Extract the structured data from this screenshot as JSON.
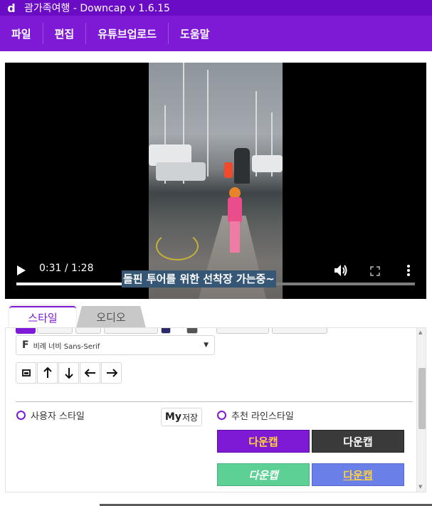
{
  "window": {
    "logo_glyph": "d",
    "title": "괌가족여행 - Downcap v 1.6.15"
  },
  "menu": [
    {
      "label": "파일"
    },
    {
      "label": "편집"
    },
    {
      "label": "유튜브업로드"
    },
    {
      "label": "도움말"
    }
  ],
  "video": {
    "subtitle": "돌핀 투어를 위한 선착장 가는중~",
    "time": "0:31 / 1:28",
    "progress_fraction": 0.352
  },
  "tabs": [
    {
      "label": "스타일",
      "active": true
    },
    {
      "label": "오디오",
      "active": false
    }
  ],
  "style_panel": {
    "font_icon": "F",
    "font_name": "비례 너비 Sans-Serif",
    "align_buttons": [
      {
        "name": "position-box-icon",
        "glyph": ""
      },
      {
        "name": "arrow-up-icon",
        "glyph": "🠕"
      },
      {
        "name": "arrow-down-icon",
        "glyph": "🠗"
      },
      {
        "name": "arrow-left-icon",
        "glyph": "🠔"
      },
      {
        "name": "arrow-right-icon",
        "glyph": "🠖"
      }
    ],
    "user_style_label": "사용자 스타일",
    "my_save": {
      "my": "My",
      "save": "저장"
    },
    "recommended_label": "추천 라인스타일",
    "style_presets": [
      {
        "label": "다운캡",
        "bg": "#7e1ad6",
        "fg": "#ffd23a"
      },
      {
        "label": "다운캡",
        "bg": "#3a3a3a",
        "fg": "#ffffff"
      },
      {
        "label": "다운캡",
        "bg": "#5dd195",
        "fg": "#ffffff"
      },
      {
        "label": "다운캡",
        "bg": "#6a7fe8",
        "fg": "#ffd23a"
      }
    ]
  },
  "colors": {
    "accent": "#7e1ad6",
    "titlebar": "#6a0cc4"
  }
}
